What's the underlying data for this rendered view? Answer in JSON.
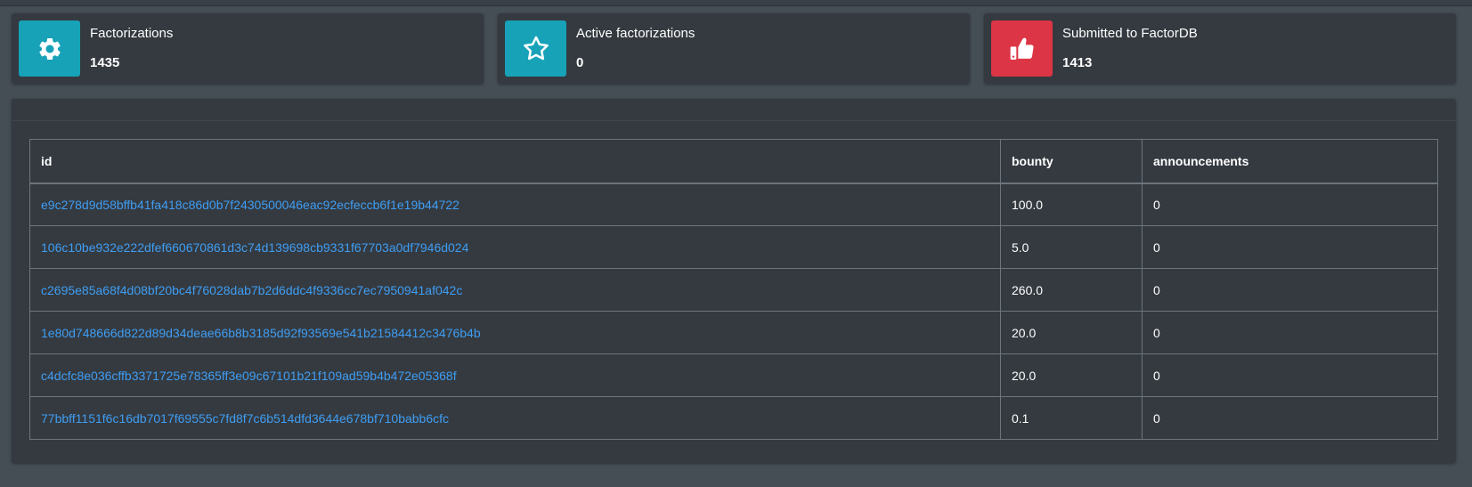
{
  "info_boxes": [
    {
      "label": "Factorizations",
      "value": "1435",
      "icon": "gear-icon",
      "color": "#17a2b8"
    },
    {
      "label": "Active factorizations",
      "value": "0",
      "icon": "star-icon",
      "color": "#17a2b8"
    },
    {
      "label": "Submitted to FactorDB",
      "value": "1413",
      "icon": "thumbs-up-icon",
      "color": "#dc3545"
    }
  ],
  "table": {
    "headers": [
      "id",
      "bounty",
      "announcements"
    ],
    "rows": [
      {
        "id": "e9c278d9d58bffb41fa418c86d0b7f2430500046eac92ecfeccb6f1e19b44722",
        "bounty": "100.0",
        "announcements": "0"
      },
      {
        "id": "106c10be932e222dfef660670861d3c74d139698cb9331f67703a0df7946d024",
        "bounty": "5.0",
        "announcements": "0"
      },
      {
        "id": "c2695e85a68f4d08bf20bc4f76028dab7b2d6ddc4f9336cc7ec7950941af042c",
        "bounty": "260.0",
        "announcements": "0"
      },
      {
        "id": "1e80d748666d822d89d34deae66b8b3185d92f93569e541b21584412c3476b4b",
        "bounty": "20.0",
        "announcements": "0"
      },
      {
        "id": "c4dcfc8e036cffb3371725e78365ff3e09c67101b21f109ad59b4b472e05368f",
        "bounty": "20.0",
        "announcements": "0"
      },
      {
        "id": "77bbff1151f6c16db7017f69555c7fd8f7c6b514dfd3644e678bf710babb6cfc",
        "bounty": "0.1",
        "announcements": "0"
      }
    ]
  }
}
